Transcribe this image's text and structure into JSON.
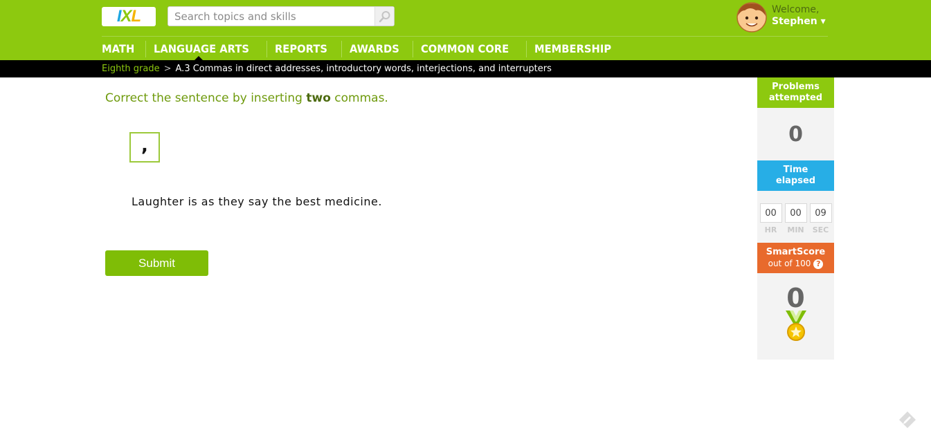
{
  "header": {
    "logo": "IXL",
    "search_placeholder": "Search topics and skills",
    "welcome": "Welcome,",
    "username": "Stephen ▾",
    "brand_color": "#8dc90f"
  },
  "nav": {
    "items": [
      "MATH",
      "LANGUAGE ARTS",
      "REPORTS",
      "AWARDS",
      "COMMON CORE",
      "MEMBERSHIP"
    ]
  },
  "breadcrumb": {
    "grade": "Eighth grade",
    "separator": ">",
    "skill": "A.3 Commas in direct addresses, introductory words, interjections, and interrupters"
  },
  "question": {
    "instruction_pre": "Correct the sentence by inserting ",
    "instruction_bold": "two",
    "instruction_post": " commas.",
    "tile": ",",
    "sentence": "Laughter is as they say the best medicine.",
    "submit_label": "Submit"
  },
  "sidebar": {
    "problems_title_1": "Problems",
    "problems_title_2": "attempted",
    "problems_value": "0",
    "problems_color": "#8dc90f",
    "time_title_1": "Time",
    "time_title_2": "elapsed",
    "time_color": "#27aee6",
    "time_hr": "00",
    "time_min": "00",
    "time_sec": "09",
    "label_hr": "HR",
    "label_min": "MIN",
    "label_sec": "SEC",
    "smart_title": "SmartScore",
    "smart_sub": "out of 100",
    "smart_help": "?",
    "smart_color": "#e86a2c",
    "smart_value": "0"
  }
}
